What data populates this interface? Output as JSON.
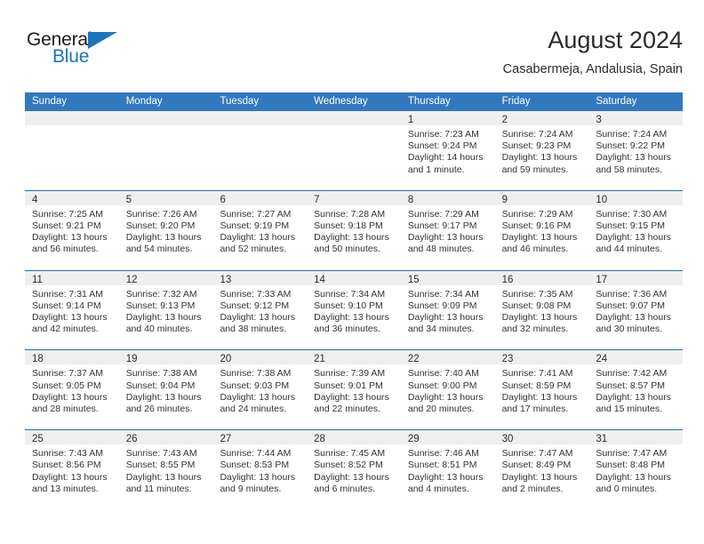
{
  "brand": {
    "name_part1": "General",
    "name_part2": "Blue",
    "triangle_color": "#1b76bd",
    "text_color": "#1a1a1a",
    "blue_color": "#1278be"
  },
  "header": {
    "title": "August 2024",
    "subtitle": "Casabermeja, Andalusia, Spain"
  },
  "theme": {
    "header_bar_bg": "#3278be",
    "header_bar_text": "#ffffff",
    "day_band_bg": "#efefef",
    "row_separator": "#2d6ca8"
  },
  "weekdays": [
    "Sunday",
    "Monday",
    "Tuesday",
    "Wednesday",
    "Thursday",
    "Friday",
    "Saturday"
  ],
  "weeks": [
    [
      {
        "day": "",
        "sunrise": "",
        "sunset": "",
        "daylight": ""
      },
      {
        "day": "",
        "sunrise": "",
        "sunset": "",
        "daylight": ""
      },
      {
        "day": "",
        "sunrise": "",
        "sunset": "",
        "daylight": ""
      },
      {
        "day": "",
        "sunrise": "",
        "sunset": "",
        "daylight": ""
      },
      {
        "day": "1",
        "sunrise": "Sunrise: 7:23 AM",
        "sunset": "Sunset: 9:24 PM",
        "daylight": "Daylight: 14 hours and 1 minute."
      },
      {
        "day": "2",
        "sunrise": "Sunrise: 7:24 AM",
        "sunset": "Sunset: 9:23 PM",
        "daylight": "Daylight: 13 hours and 59 minutes."
      },
      {
        "day": "3",
        "sunrise": "Sunrise: 7:24 AM",
        "sunset": "Sunset: 9:22 PM",
        "daylight": "Daylight: 13 hours and 58 minutes."
      }
    ],
    [
      {
        "day": "4",
        "sunrise": "Sunrise: 7:25 AM",
        "sunset": "Sunset: 9:21 PM",
        "daylight": "Daylight: 13 hours and 56 minutes."
      },
      {
        "day": "5",
        "sunrise": "Sunrise: 7:26 AM",
        "sunset": "Sunset: 9:20 PM",
        "daylight": "Daylight: 13 hours and 54 minutes."
      },
      {
        "day": "6",
        "sunrise": "Sunrise: 7:27 AM",
        "sunset": "Sunset: 9:19 PM",
        "daylight": "Daylight: 13 hours and 52 minutes."
      },
      {
        "day": "7",
        "sunrise": "Sunrise: 7:28 AM",
        "sunset": "Sunset: 9:18 PM",
        "daylight": "Daylight: 13 hours and 50 minutes."
      },
      {
        "day": "8",
        "sunrise": "Sunrise: 7:29 AM",
        "sunset": "Sunset: 9:17 PM",
        "daylight": "Daylight: 13 hours and 48 minutes."
      },
      {
        "day": "9",
        "sunrise": "Sunrise: 7:29 AM",
        "sunset": "Sunset: 9:16 PM",
        "daylight": "Daylight: 13 hours and 46 minutes."
      },
      {
        "day": "10",
        "sunrise": "Sunrise: 7:30 AM",
        "sunset": "Sunset: 9:15 PM",
        "daylight": "Daylight: 13 hours and 44 minutes."
      }
    ],
    [
      {
        "day": "11",
        "sunrise": "Sunrise: 7:31 AM",
        "sunset": "Sunset: 9:14 PM",
        "daylight": "Daylight: 13 hours and 42 minutes."
      },
      {
        "day": "12",
        "sunrise": "Sunrise: 7:32 AM",
        "sunset": "Sunset: 9:13 PM",
        "daylight": "Daylight: 13 hours and 40 minutes."
      },
      {
        "day": "13",
        "sunrise": "Sunrise: 7:33 AM",
        "sunset": "Sunset: 9:12 PM",
        "daylight": "Daylight: 13 hours and 38 minutes."
      },
      {
        "day": "14",
        "sunrise": "Sunrise: 7:34 AM",
        "sunset": "Sunset: 9:10 PM",
        "daylight": "Daylight: 13 hours and 36 minutes."
      },
      {
        "day": "15",
        "sunrise": "Sunrise: 7:34 AM",
        "sunset": "Sunset: 9:09 PM",
        "daylight": "Daylight: 13 hours and 34 minutes."
      },
      {
        "day": "16",
        "sunrise": "Sunrise: 7:35 AM",
        "sunset": "Sunset: 9:08 PM",
        "daylight": "Daylight: 13 hours and 32 minutes."
      },
      {
        "day": "17",
        "sunrise": "Sunrise: 7:36 AM",
        "sunset": "Sunset: 9:07 PM",
        "daylight": "Daylight: 13 hours and 30 minutes."
      }
    ],
    [
      {
        "day": "18",
        "sunrise": "Sunrise: 7:37 AM",
        "sunset": "Sunset: 9:05 PM",
        "daylight": "Daylight: 13 hours and 28 minutes."
      },
      {
        "day": "19",
        "sunrise": "Sunrise: 7:38 AM",
        "sunset": "Sunset: 9:04 PM",
        "daylight": "Daylight: 13 hours and 26 minutes."
      },
      {
        "day": "20",
        "sunrise": "Sunrise: 7:38 AM",
        "sunset": "Sunset: 9:03 PM",
        "daylight": "Daylight: 13 hours and 24 minutes."
      },
      {
        "day": "21",
        "sunrise": "Sunrise: 7:39 AM",
        "sunset": "Sunset: 9:01 PM",
        "daylight": "Daylight: 13 hours and 22 minutes."
      },
      {
        "day": "22",
        "sunrise": "Sunrise: 7:40 AM",
        "sunset": "Sunset: 9:00 PM",
        "daylight": "Daylight: 13 hours and 20 minutes."
      },
      {
        "day": "23",
        "sunrise": "Sunrise: 7:41 AM",
        "sunset": "Sunset: 8:59 PM",
        "daylight": "Daylight: 13 hours and 17 minutes."
      },
      {
        "day": "24",
        "sunrise": "Sunrise: 7:42 AM",
        "sunset": "Sunset: 8:57 PM",
        "daylight": "Daylight: 13 hours and 15 minutes."
      }
    ],
    [
      {
        "day": "25",
        "sunrise": "Sunrise: 7:43 AM",
        "sunset": "Sunset: 8:56 PM",
        "daylight": "Daylight: 13 hours and 13 minutes."
      },
      {
        "day": "26",
        "sunrise": "Sunrise: 7:43 AM",
        "sunset": "Sunset: 8:55 PM",
        "daylight": "Daylight: 13 hours and 11 minutes."
      },
      {
        "day": "27",
        "sunrise": "Sunrise: 7:44 AM",
        "sunset": "Sunset: 8:53 PM",
        "daylight": "Daylight: 13 hours and 9 minutes."
      },
      {
        "day": "28",
        "sunrise": "Sunrise: 7:45 AM",
        "sunset": "Sunset: 8:52 PM",
        "daylight": "Daylight: 13 hours and 6 minutes."
      },
      {
        "day": "29",
        "sunrise": "Sunrise: 7:46 AM",
        "sunset": "Sunset: 8:51 PM",
        "daylight": "Daylight: 13 hours and 4 minutes."
      },
      {
        "day": "30",
        "sunrise": "Sunrise: 7:47 AM",
        "sunset": "Sunset: 8:49 PM",
        "daylight": "Daylight: 13 hours and 2 minutes."
      },
      {
        "day": "31",
        "sunrise": "Sunrise: 7:47 AM",
        "sunset": "Sunset: 8:48 PM",
        "daylight": "Daylight: 13 hours and 0 minutes."
      }
    ]
  ]
}
